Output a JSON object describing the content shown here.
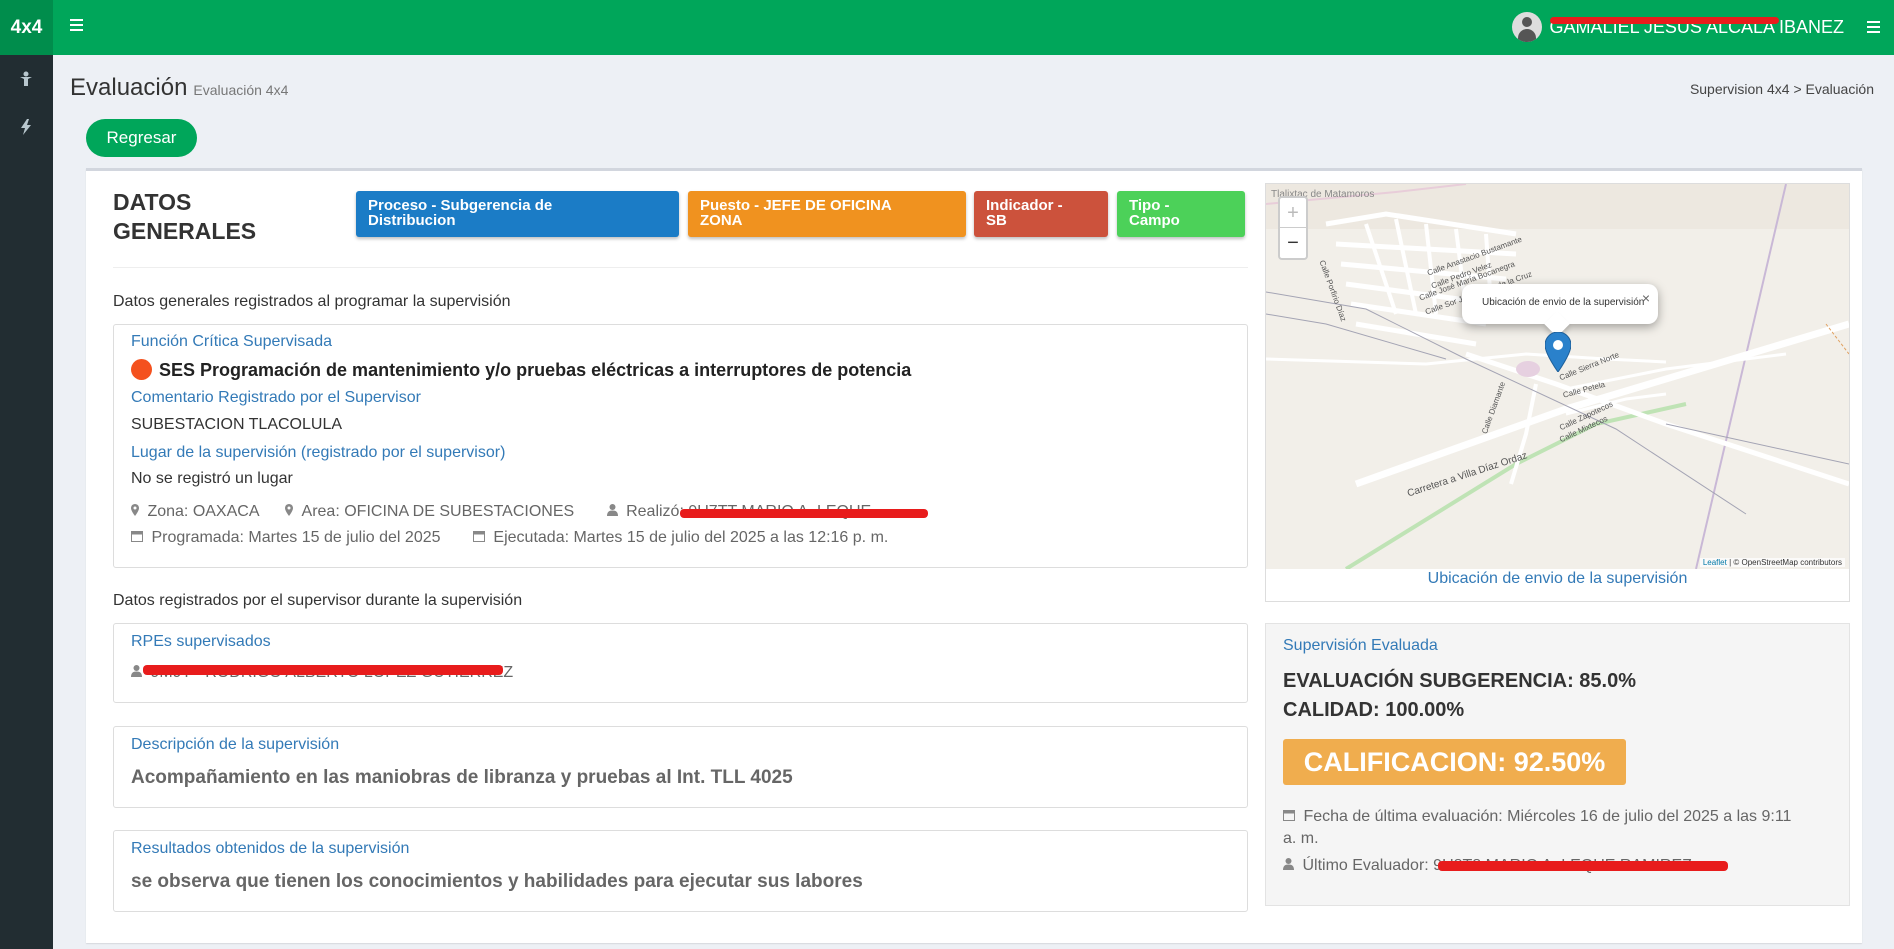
{
  "brand": "4x4",
  "user": {
    "name": "GAMALIEL JESUS ALCALA IBANEZ"
  },
  "header": {
    "title": "Evaluación",
    "subtitle": "Evaluación 4x4",
    "breadcrumb": "Supervision 4x4 > Evaluación",
    "back_button": "Regresar"
  },
  "general": {
    "title_line1": "DATOS",
    "title_line2": "GENERALES",
    "tags": {
      "proceso_l1": "Proceso - Subgerencia de",
      "proceso_l2": "Distribucion",
      "puesto_l1": "Puesto - JEFE DE OFICINA",
      "puesto_l2": "ZONA",
      "indicador_l1": "Indicador -",
      "indicador_l2": "SB",
      "tipo_l1": "Tipo -",
      "tipo_l2": "Campo"
    },
    "tag_colors": {
      "proceso": "#1b7cc6",
      "puesto": "#f0921f",
      "indicador": "#cc523c",
      "tipo": "#4cd159"
    },
    "section1": "Datos generales registrados al programar la supervisión",
    "funcion_label": "Función Crítica Supervisada",
    "funcion_value": "SES Programación de mantenimiento y/o pruebas eléctricas a interruptores de potencia",
    "comentario_label": "Comentario Registrado por el Supervisor",
    "comentario_value": "SUBESTACION TLACOLULA",
    "lugar_label": "Lugar de la supervisión (registrado por el supervisor)",
    "lugar_value": "No se registró un lugar",
    "zona": "Zona: OAXACA",
    "area": "Area: OFICINA DE SUBESTACIONES",
    "realizo": "Realizó: 9U7TT MARIO A. LEQUE",
    "programada": "Programada: Martes 15 de julio del 2025",
    "ejecutada": "Ejecutada: Martes 15 de julio del 2025 a las 12:16 p. m.",
    "section2": "Datos registrados por el supervisor durante la supervisión",
    "rpes_label": "RPEs supervisados",
    "rpes_value": "9M9T - RODRIGO ALBERTO LOPEZ GUTIERREZ",
    "descripcion_label": "Descripción de la supervisión",
    "descripcion_value": "Acompañamiento en las maniobras de libranza y pruebas al Int. TLL 4025",
    "resultados_label": "Resultados obtenidos de la supervisión",
    "resultados_value": "se observa que tienen los conocimientos y habilidades para ejecutar sus labores"
  },
  "map": {
    "zoom_in": "+",
    "zoom_out": "−",
    "popup_text": "Ubicación de envio de la supervisión",
    "popup_close": "×",
    "attrib_leaflet": "Leaflet",
    "attrib_osm": "| © OpenStreetMap contributors",
    "caption": "Ubicación de envio de la supervisión",
    "streets": {
      "matamoros": "Tlalixtac de Matamoros",
      "porfirio": "Calle Porfirio Díaz",
      "bustamante": "Calle Anastacio Bustamante",
      "pedro": "Calle Pedro Velez",
      "bocanegra": "Calle José María Bocanegra",
      "cruz": "Calle Sor Juana Inés de la Cruz",
      "sierra": "Calle Sierra Norte",
      "petela": "Calle Petela",
      "zapotecos": "Calle Zapotecos",
      "mixtecos": "Calle Mixtecos",
      "diamante": "Calle Diamante",
      "carretera": "Carretera a Villa Díaz Ordaz"
    }
  },
  "evaluation": {
    "label": "Supervisión Evaluada",
    "subgerencia": "EVALUACIÓN SUBGERENCIA: 85.0%",
    "calidad": "CALIDAD: 100.00%",
    "calificacion": "CALIFICACION: 92.50%",
    "fecha": "Fecha de última evaluación: Miércoles 16 de julio del 2025 a las 9:11 a. m.",
    "evaluador": "Último Evaluador: 9U8T8 MARIO A. LEQUE RAMIREZ"
  },
  "icons": {
    "menu": "hamburger-icon",
    "sidebar1": "person-icon",
    "sidebar2": "bolt-icon",
    "marker": "map-marker-icon",
    "user": "user-icon",
    "calendar": "calendar-icon"
  }
}
